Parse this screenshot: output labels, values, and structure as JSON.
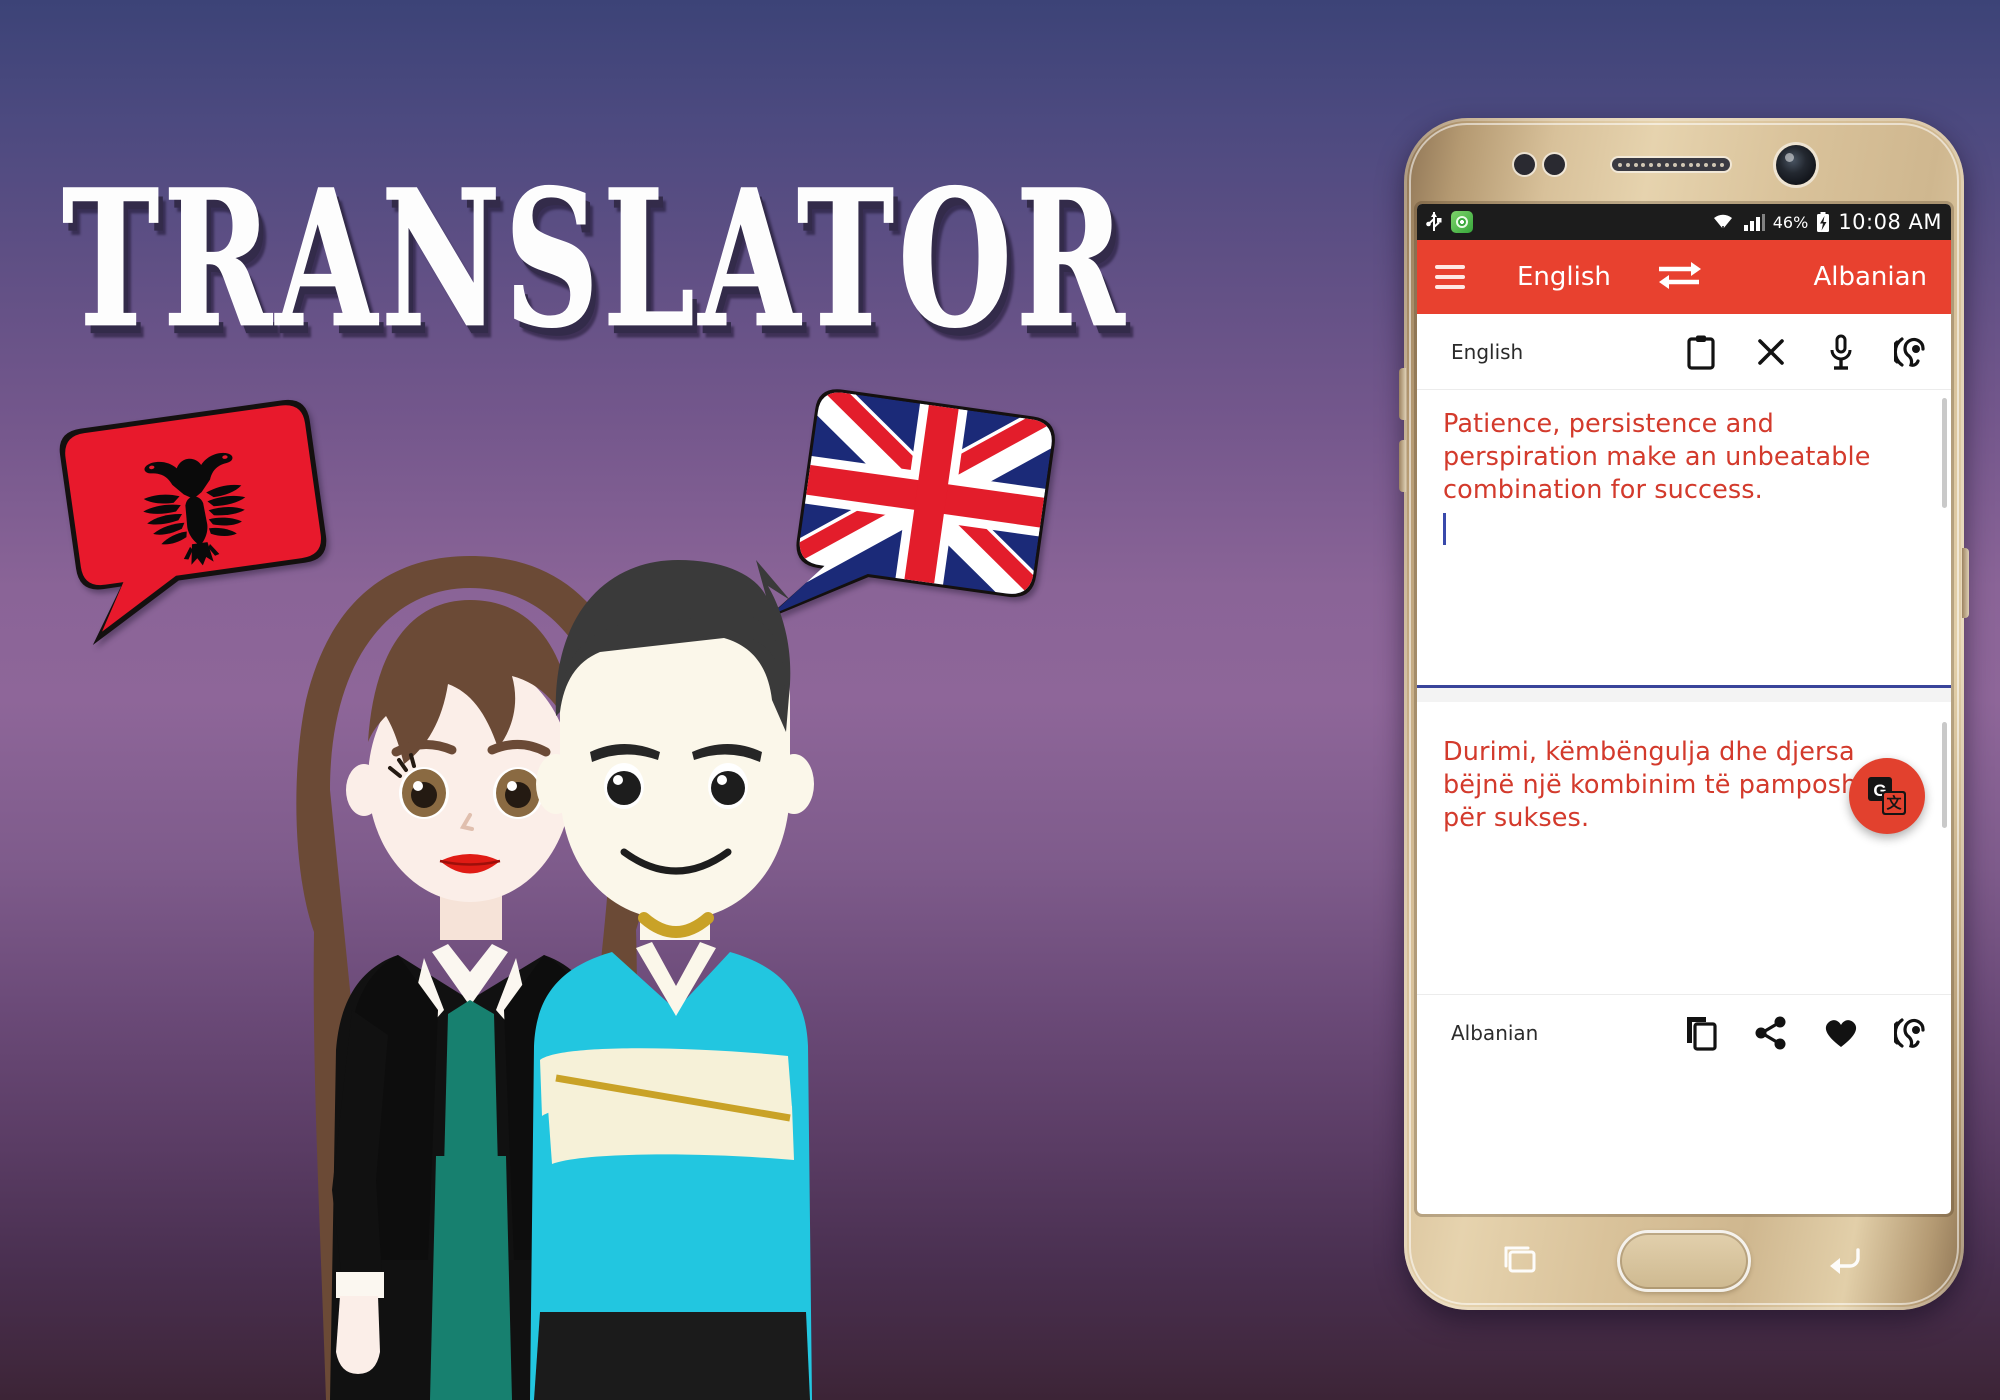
{
  "banner": {
    "title": "TRANSLATOR",
    "background_top_color": "#3c4377",
    "background_mid_color": "#8e6699",
    "background_bottom_color": "#3c2436"
  },
  "bubbles": [
    {
      "name": "albanian-flag-bubble",
      "country": "Albania",
      "primary_color": "#e8192c",
      "emblem_color": "#000000"
    },
    {
      "name": "uk-flag-bubble",
      "country": "United Kingdom",
      "blue": "#1b2a78",
      "red": "#e31d2b",
      "white": "#ffffff"
    }
  ],
  "characters": [
    {
      "name": "female-character",
      "hair_color": "#6b4a36",
      "jacket_color": "#111111",
      "dress_color": "#17806f",
      "lips_color": "#e01b14"
    },
    {
      "name": "male-character",
      "hair_color": "#3a3a3a",
      "shirt_color": "#22c6e0",
      "necklace_color": "#c9a227"
    }
  ],
  "phone": {
    "body_color": "#d9c29a",
    "statusbar": {
      "usb_icon": "usb-icon",
      "app_icon": "green-circle-app-icon",
      "wifi_icon": "wifi-icon",
      "signal_icon": "signal-bars-icon",
      "battery_percent": "46%",
      "battery_icon": "battery-charging-icon",
      "time": "10:08 AM"
    },
    "appbar": {
      "menu_icon": "hamburger-menu-icon",
      "source_language": "English",
      "swap_icon": "swap-languages-icon",
      "target_language": "Albanian",
      "background_color": "#e8412f"
    },
    "source_panel": {
      "label": "English",
      "text": "Patience, persistence and perspiration make an unbeatable combination for success.",
      "text_color": "#d33a2c",
      "caret_color": "#3949ab",
      "underline_color": "#39449a",
      "actions": [
        {
          "name": "paste-icon",
          "label": "Paste"
        },
        {
          "name": "clear-icon",
          "label": "Clear"
        },
        {
          "name": "microphone-icon",
          "label": "Voice input"
        },
        {
          "name": "listen-icon",
          "label": "Listen"
        }
      ]
    },
    "translate_button": {
      "name": "translate-fab",
      "label": "Translate",
      "color": "#e2412e",
      "icon": "google-translate-icon"
    },
    "target_panel": {
      "label": "Albanian",
      "text": "Durimi, këmbëngulja dhe djersa bëjnë një kombinim të pamposhtur për sukses.",
      "text_color": "#d33a2c",
      "actions": [
        {
          "name": "copy-icon",
          "label": "Copy"
        },
        {
          "name": "share-icon",
          "label": "Share"
        },
        {
          "name": "favorite-icon",
          "label": "Favorite"
        },
        {
          "name": "listen-icon",
          "label": "Listen"
        }
      ]
    },
    "navigation": {
      "recents_icon": "recents-icon",
      "home_button": "home-button",
      "back_icon": "back-icon"
    }
  }
}
